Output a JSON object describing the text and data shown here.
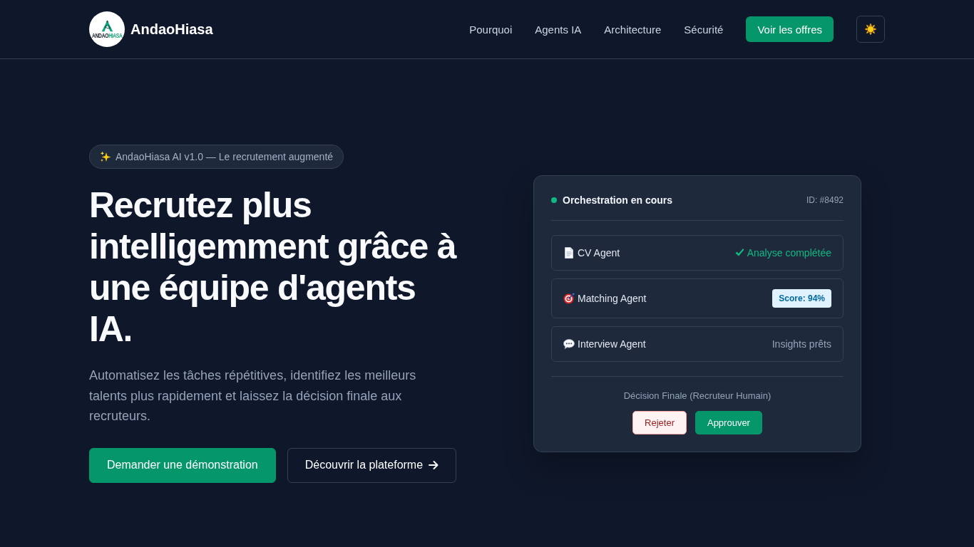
{
  "header": {
    "brand": "AndaoHiasa",
    "logo_wordmark": [
      "ANDAO",
      "HIASA"
    ],
    "nav_links": [
      "Pourquoi",
      "Agents IA",
      "Architecture",
      "Sécurité"
    ],
    "cta": "Voir les offres"
  },
  "hero": {
    "badge": "AndaoHiasa AI v1.0 — Le recrutement augmenté",
    "title": "Recrutez plus intelligemment grâce à une équipe d'agents IA.",
    "subtitle": "Automatisez les tâches répétitives, identifiez les meilleurs talents plus rapidement et laissez la décision finale aux recruteurs.",
    "primary_button": "Demander une démonstration",
    "secondary_button": "Découvrir la plateforme"
  },
  "orchestration_card": {
    "title": "Orchestration en cours",
    "id": "ID: #8492",
    "agents": [
      {
        "name": "CV Agent",
        "status": {
          "kind": "success",
          "text": "Analyse complétée"
        }
      },
      {
        "name": "Matching Agent",
        "status": {
          "kind": "badge",
          "text": "Score: 94%"
        }
      },
      {
        "name": "Interview Agent",
        "status": {
          "kind": "muted",
          "text": "Insights prêts"
        }
      }
    ],
    "decision_label": "Décision Finale (Recruteur Humain)",
    "buttons": [
      {
        "kind": "reject",
        "label": "Rejeter"
      },
      {
        "kind": "approve",
        "label": "Approuver"
      }
    ]
  }
}
